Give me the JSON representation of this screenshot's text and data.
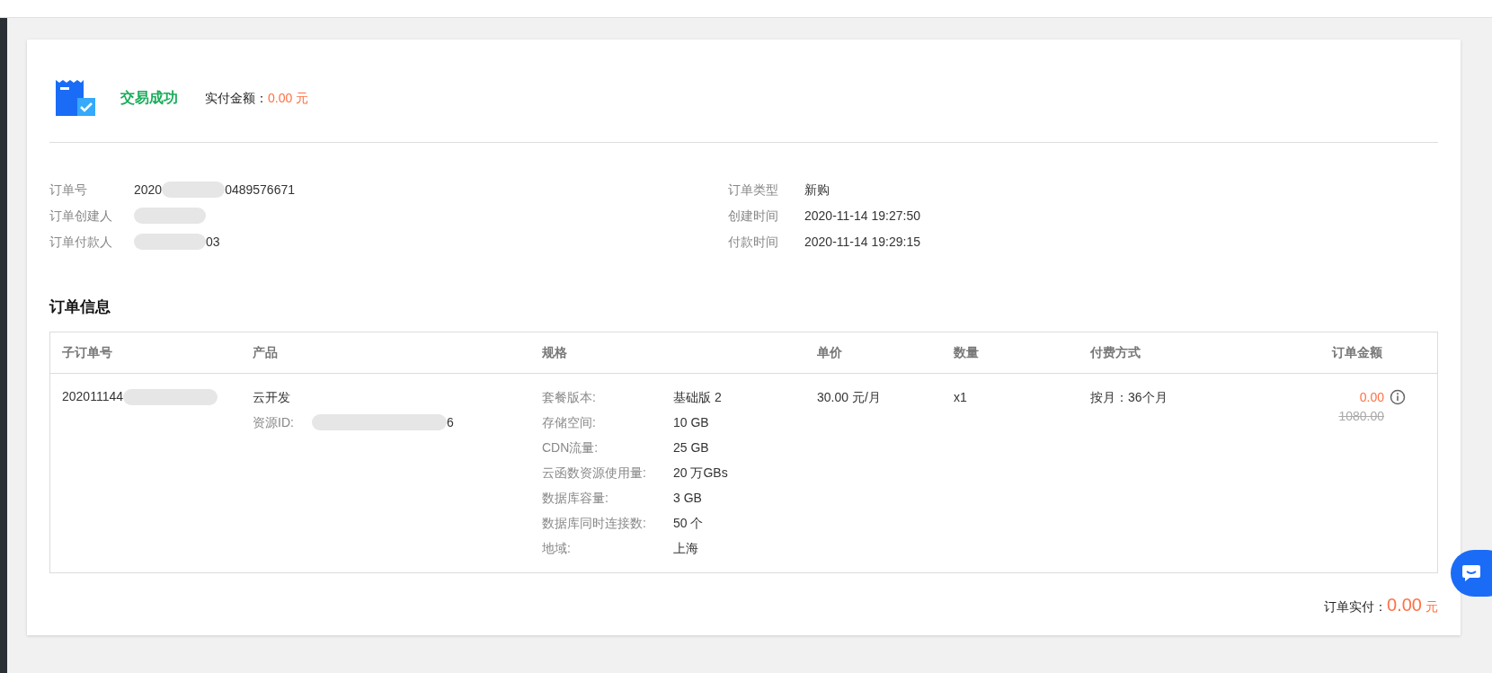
{
  "header": {
    "status": "交易成功",
    "paid_label": "实付金额：",
    "paid_amount": "0.00 元"
  },
  "details_left": [
    {
      "label": "订单号",
      "value_start": "2020",
      "value_end": "0489576671",
      "redacted": true
    },
    {
      "label": "订单创建人",
      "redacted": true
    },
    {
      "label": "订单付款人",
      "value_end": "03",
      "redacted": true
    }
  ],
  "details_right": [
    {
      "label": "订单类型",
      "value": "新购"
    },
    {
      "label": "创建时间",
      "value": "2020-11-14 19:27:50"
    },
    {
      "label": "付款时间",
      "value": "2020-11-14 19:29:15"
    }
  ],
  "section_title": "订单信息",
  "table": {
    "columns": [
      "子订单号",
      "产品",
      "规格",
      "单价",
      "数量",
      "付费方式",
      "订单金额"
    ],
    "rows": [
      {
        "sub_order_start": "202011144",
        "product": "云开发",
        "resource_label": "资源ID:",
        "resource_end": "6",
        "specs": [
          {
            "label": "套餐版本:",
            "value": "基础版 2"
          },
          {
            "label": "存储空间:",
            "value": "10 GB"
          },
          {
            "label": "CDN流量:",
            "value": "25 GB"
          },
          {
            "label": "云函数资源使用量:",
            "value": "20 万GBs"
          },
          {
            "label": "数据库容量:",
            "value": "3 GB"
          },
          {
            "label": "数据库同时连接数:",
            "value": "50 个"
          },
          {
            "label": "地域:",
            "value": "上海"
          }
        ],
        "unit_price": "30.00 元/月",
        "quantity": "x1",
        "billing": "按月：36个月",
        "amount": "0.00",
        "original_amount": "1080.00"
      }
    ]
  },
  "footer": {
    "label": "订单实付：",
    "amount": "0.00",
    "unit": "元"
  }
}
